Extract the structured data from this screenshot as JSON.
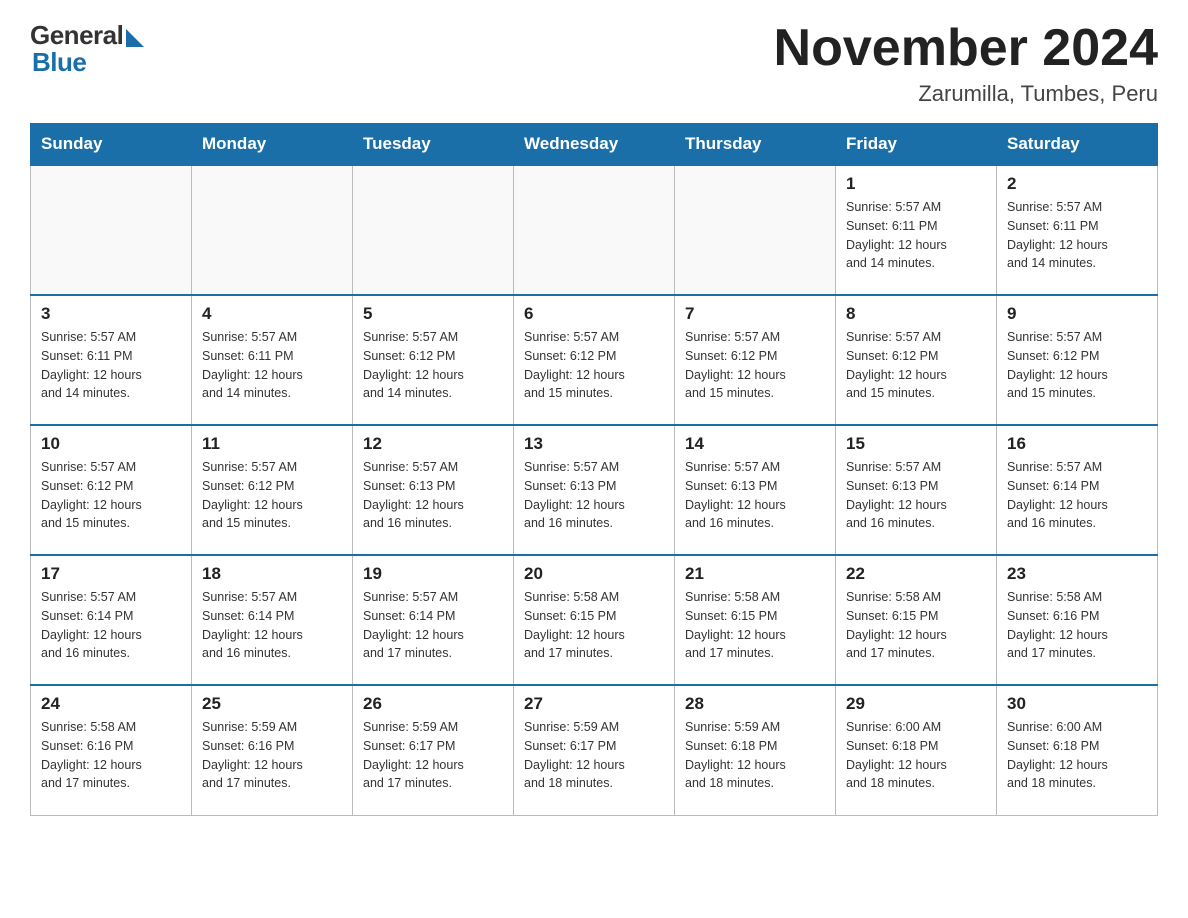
{
  "header": {
    "logo": {
      "general": "General",
      "blue": "Blue"
    },
    "title": "November 2024",
    "subtitle": "Zarumilla, Tumbes, Peru"
  },
  "calendar": {
    "days": [
      "Sunday",
      "Monday",
      "Tuesday",
      "Wednesday",
      "Thursday",
      "Friday",
      "Saturday"
    ],
    "weeks": [
      [
        {
          "day": "",
          "info": ""
        },
        {
          "day": "",
          "info": ""
        },
        {
          "day": "",
          "info": ""
        },
        {
          "day": "",
          "info": ""
        },
        {
          "day": "",
          "info": ""
        },
        {
          "day": "1",
          "info": "Sunrise: 5:57 AM\nSunset: 6:11 PM\nDaylight: 12 hours\nand 14 minutes."
        },
        {
          "day": "2",
          "info": "Sunrise: 5:57 AM\nSunset: 6:11 PM\nDaylight: 12 hours\nand 14 minutes."
        }
      ],
      [
        {
          "day": "3",
          "info": "Sunrise: 5:57 AM\nSunset: 6:11 PM\nDaylight: 12 hours\nand 14 minutes."
        },
        {
          "day": "4",
          "info": "Sunrise: 5:57 AM\nSunset: 6:11 PM\nDaylight: 12 hours\nand 14 minutes."
        },
        {
          "day": "5",
          "info": "Sunrise: 5:57 AM\nSunset: 6:12 PM\nDaylight: 12 hours\nand 14 minutes."
        },
        {
          "day": "6",
          "info": "Sunrise: 5:57 AM\nSunset: 6:12 PM\nDaylight: 12 hours\nand 15 minutes."
        },
        {
          "day": "7",
          "info": "Sunrise: 5:57 AM\nSunset: 6:12 PM\nDaylight: 12 hours\nand 15 minutes."
        },
        {
          "day": "8",
          "info": "Sunrise: 5:57 AM\nSunset: 6:12 PM\nDaylight: 12 hours\nand 15 minutes."
        },
        {
          "day": "9",
          "info": "Sunrise: 5:57 AM\nSunset: 6:12 PM\nDaylight: 12 hours\nand 15 minutes."
        }
      ],
      [
        {
          "day": "10",
          "info": "Sunrise: 5:57 AM\nSunset: 6:12 PM\nDaylight: 12 hours\nand 15 minutes."
        },
        {
          "day": "11",
          "info": "Sunrise: 5:57 AM\nSunset: 6:12 PM\nDaylight: 12 hours\nand 15 minutes."
        },
        {
          "day": "12",
          "info": "Sunrise: 5:57 AM\nSunset: 6:13 PM\nDaylight: 12 hours\nand 16 minutes."
        },
        {
          "day": "13",
          "info": "Sunrise: 5:57 AM\nSunset: 6:13 PM\nDaylight: 12 hours\nand 16 minutes."
        },
        {
          "day": "14",
          "info": "Sunrise: 5:57 AM\nSunset: 6:13 PM\nDaylight: 12 hours\nand 16 minutes."
        },
        {
          "day": "15",
          "info": "Sunrise: 5:57 AM\nSunset: 6:13 PM\nDaylight: 12 hours\nand 16 minutes."
        },
        {
          "day": "16",
          "info": "Sunrise: 5:57 AM\nSunset: 6:14 PM\nDaylight: 12 hours\nand 16 minutes."
        }
      ],
      [
        {
          "day": "17",
          "info": "Sunrise: 5:57 AM\nSunset: 6:14 PM\nDaylight: 12 hours\nand 16 minutes."
        },
        {
          "day": "18",
          "info": "Sunrise: 5:57 AM\nSunset: 6:14 PM\nDaylight: 12 hours\nand 16 minutes."
        },
        {
          "day": "19",
          "info": "Sunrise: 5:57 AM\nSunset: 6:14 PM\nDaylight: 12 hours\nand 17 minutes."
        },
        {
          "day": "20",
          "info": "Sunrise: 5:58 AM\nSunset: 6:15 PM\nDaylight: 12 hours\nand 17 minutes."
        },
        {
          "day": "21",
          "info": "Sunrise: 5:58 AM\nSunset: 6:15 PM\nDaylight: 12 hours\nand 17 minutes."
        },
        {
          "day": "22",
          "info": "Sunrise: 5:58 AM\nSunset: 6:15 PM\nDaylight: 12 hours\nand 17 minutes."
        },
        {
          "day": "23",
          "info": "Sunrise: 5:58 AM\nSunset: 6:16 PM\nDaylight: 12 hours\nand 17 minutes."
        }
      ],
      [
        {
          "day": "24",
          "info": "Sunrise: 5:58 AM\nSunset: 6:16 PM\nDaylight: 12 hours\nand 17 minutes."
        },
        {
          "day": "25",
          "info": "Sunrise: 5:59 AM\nSunset: 6:16 PM\nDaylight: 12 hours\nand 17 minutes."
        },
        {
          "day": "26",
          "info": "Sunrise: 5:59 AM\nSunset: 6:17 PM\nDaylight: 12 hours\nand 17 minutes."
        },
        {
          "day": "27",
          "info": "Sunrise: 5:59 AM\nSunset: 6:17 PM\nDaylight: 12 hours\nand 18 minutes."
        },
        {
          "day": "28",
          "info": "Sunrise: 5:59 AM\nSunset: 6:18 PM\nDaylight: 12 hours\nand 18 minutes."
        },
        {
          "day": "29",
          "info": "Sunrise: 6:00 AM\nSunset: 6:18 PM\nDaylight: 12 hours\nand 18 minutes."
        },
        {
          "day": "30",
          "info": "Sunrise: 6:00 AM\nSunset: 6:18 PM\nDaylight: 12 hours\nand 18 minutes."
        }
      ]
    ]
  }
}
